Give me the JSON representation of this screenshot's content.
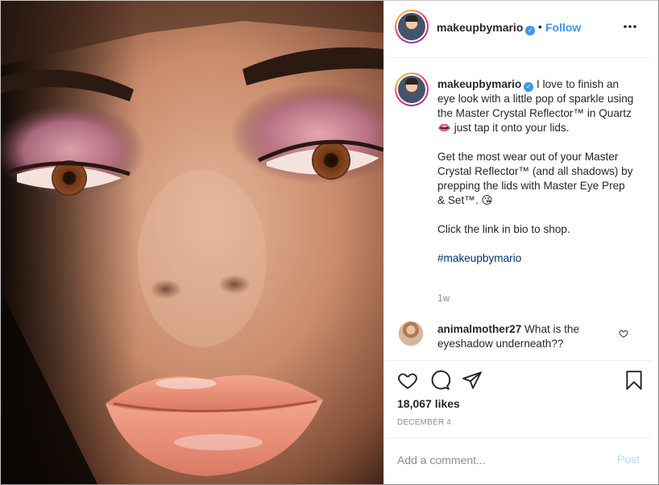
{
  "post": {
    "username": "makeupbymario",
    "verified_glyph": "✓",
    "separator": "•",
    "follow_label": "Follow",
    "more_icon": "more-horizontal-icon"
  },
  "caption": {
    "username": "makeupbymario",
    "line1": "I love to finish an eye look with a little pop of sparkle using the Master Crystal Reflector™ in Quartz 👄 just tap it onto your lids.",
    "line2": "Get the most wear out of your Master Crystal Reflector™ (and all shadows) by prepping the lids with Master Eye Prep & Set™. 😘",
    "line3": "Click the link in bio to shop.",
    "hashtag": "#makeupbymario",
    "time_ago": "1w"
  },
  "comments": [
    {
      "username": "animalmother27",
      "text": "What is the eyeshadow underneath??"
    }
  ],
  "actions": {
    "like_icon": "heart-icon",
    "comment_icon": "comment-bubble-icon",
    "share_icon": "send-icon",
    "save_icon": "bookmark-icon"
  },
  "likes": "18,067 likes",
  "date": "DECEMBER 4",
  "add_comment": {
    "placeholder": "Add a comment...",
    "post_label": "Post"
  },
  "colors": {
    "link_blue": "#3897f0",
    "hashtag_blue": "#003569",
    "muted_gray": "#8e8e8e",
    "post_disabled": "#b3dbff"
  }
}
